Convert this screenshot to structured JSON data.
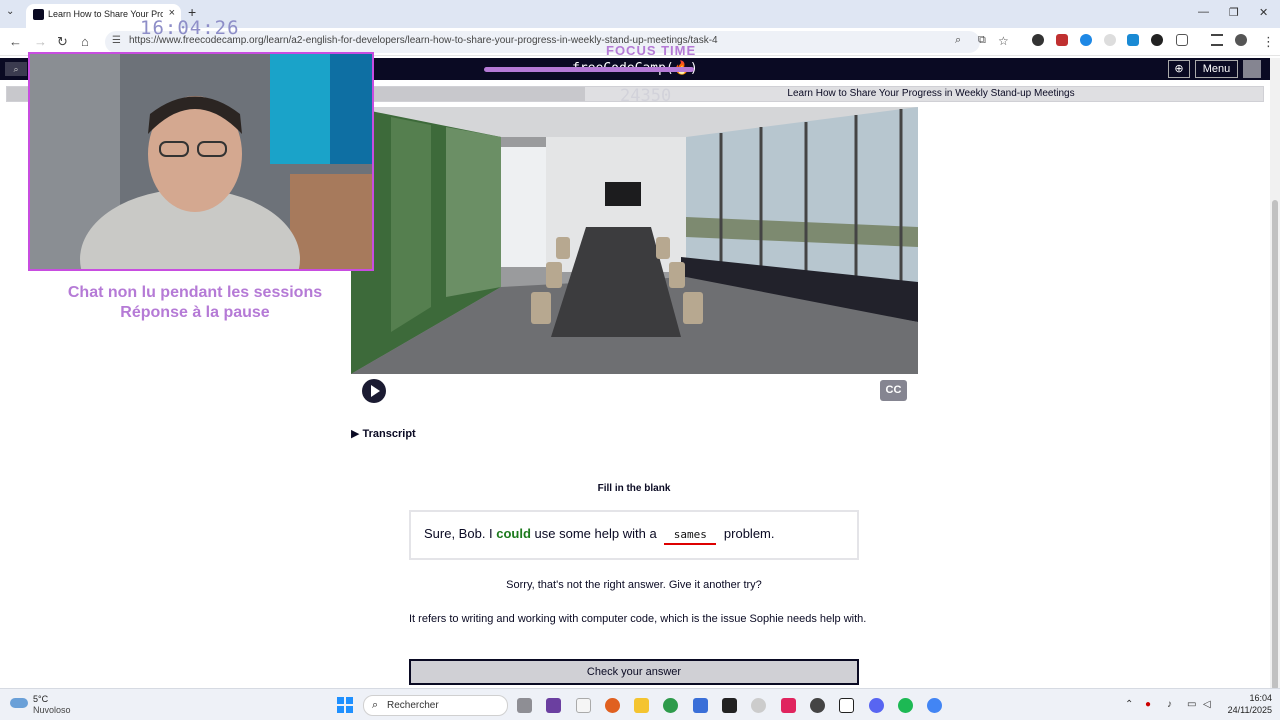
{
  "browser": {
    "tab_title": "Learn How to Share Your Progr",
    "url": "https://www.freecodecamp.org/learn/a2-english-for-developers/learn-how-to-share-your-progress-in-weekly-stand-up-meetings/task-4",
    "new_tab": "+",
    "close_tab": "×",
    "minimize": "—",
    "maximize": "❐",
    "close_window": "✕"
  },
  "fcc_nav": {
    "logo": "freeCodeCamp(🔥)",
    "menu_label": "Menu",
    "search_icon": "⌕",
    "globe_icon": "⊕"
  },
  "progress": {
    "label": "Learn How to Share Your Progress in Weekly Stand-up Meetings",
    "fraction": 0.46
  },
  "overlay": {
    "clock": "16:04:26",
    "focus_label": "FOCUS TIME",
    "score": "24350",
    "chat_line1": "Chat non lu pendant les sessions",
    "chat_line2": "Réponse à la pause"
  },
  "video": {
    "cc_label": "CC"
  },
  "lesson": {
    "transcript_label": "Transcript",
    "fill_blank_label": "Fill in the blank",
    "sentence_before": "Sure, Bob. I ",
    "sentence_bold": "could",
    "sentence_mid": " use some help with a ",
    "answer_value": "sames",
    "sentence_after": " problem.",
    "feedback": "Sorry, that's not the right answer. Give it another try?",
    "explanation": "It refers to writing and working with computer code, which is the issue Sophie needs help with.",
    "check_button": "Check your answer"
  },
  "taskbar": {
    "temperature": "5°C",
    "condition": "Nuvoloso",
    "search_placeholder": "Rechercher",
    "time": "16:04",
    "date": "24/11/2025"
  },
  "colors": {
    "fcc_dark": "#0a0a23",
    "overlay_purple": "#b57ad6",
    "answer_underline": "#dd0000"
  }
}
